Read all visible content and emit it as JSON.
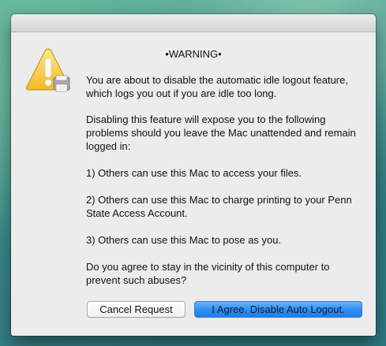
{
  "dialog": {
    "title": "•WARNING•",
    "icon": "caution-icon",
    "paragraphs": [
      "You are about to disable the automatic idle logout feature, which logs you out if you are idle too long.",
      "Disabling this feature will expose you to the following problems should you leave the Mac unattended and remain logged in:",
      "1) Others can use this Mac to access your files.",
      "2) Others can use this Mac to charge printing to your Penn State Access Account.",
      "3) Others can use this Mac to pose as you.",
      "Do you agree to stay in the vicinity of this computer to prevent such abuses?"
    ],
    "buttons": {
      "cancel_label": "Cancel Request",
      "agree_label": "I Agree. Disable Auto Logout."
    }
  },
  "colors": {
    "default_button": "#2a8ef3",
    "caution_yellow": "#f5c542"
  }
}
